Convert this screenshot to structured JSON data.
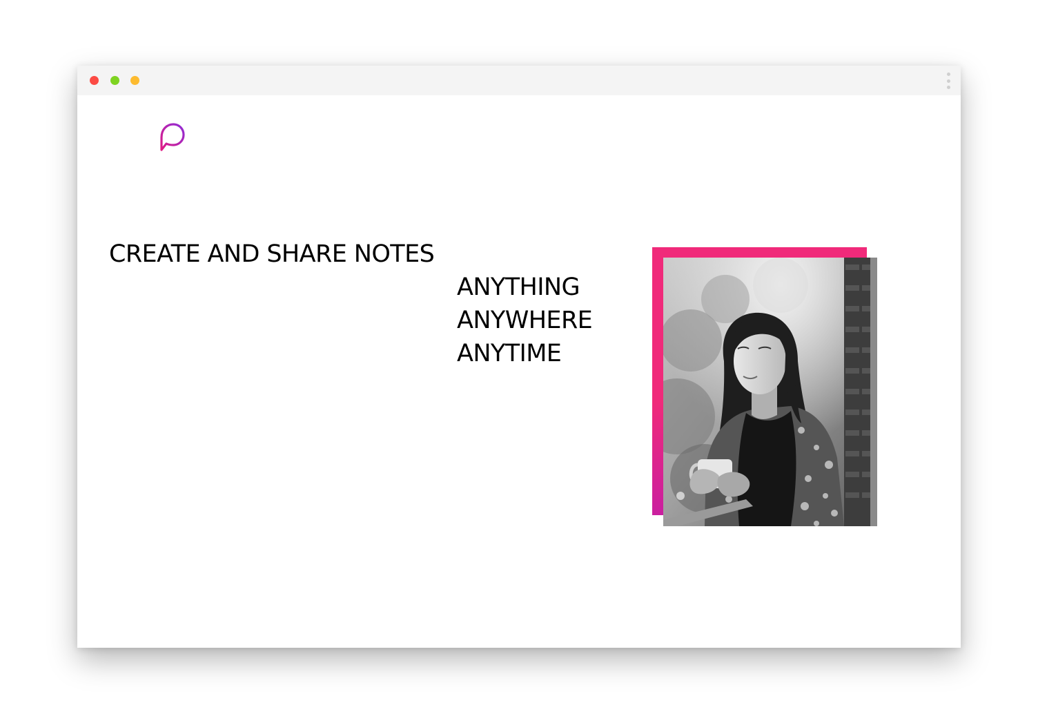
{
  "window": {
    "controls": [
      "close",
      "minimize",
      "zoom"
    ],
    "control_colors": {
      "close": "#fc4b44",
      "minimize": "#7ed321",
      "zoom": "#fdbb2f"
    },
    "menu_icon": "kebab-menu-icon"
  },
  "brand": {
    "logo_icon": "speech-bubble-logo-icon",
    "gradient": [
      "#e01b84",
      "#8f2cd7"
    ]
  },
  "hero": {
    "headline": "CREATE AND SHARE NOTES",
    "taglines": [
      "ANYTHING",
      "ANYWHERE",
      "ANYTIME"
    ],
    "frame_gradient": [
      "#f02a7a",
      "#b118b8"
    ],
    "photo": "black-and-white photo of a woman holding a mug on a balcony"
  }
}
